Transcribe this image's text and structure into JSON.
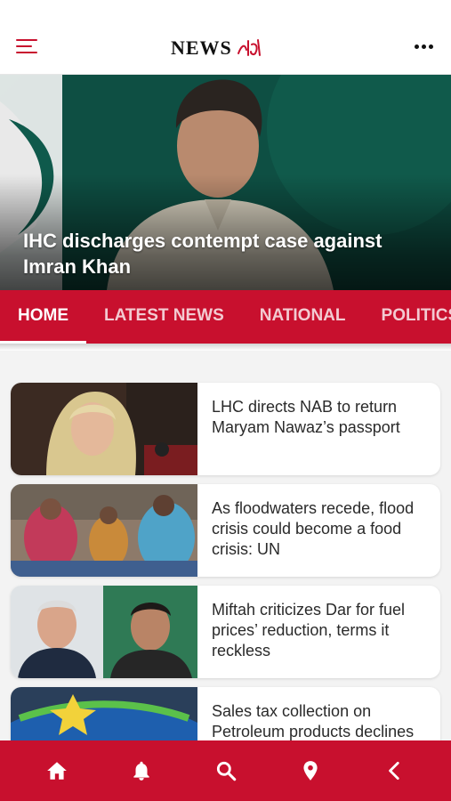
{
  "header": {
    "logo_text": "NEWS",
    "logo_urdu": "ایف ایم",
    "menu_icon": "hamburger-menu-icon",
    "more_icon": "more-dots-icon"
  },
  "hero": {
    "title": "IHC discharges contempt case against Imran Khan"
  },
  "tabs": [
    {
      "label": "HOME",
      "active": true
    },
    {
      "label": "LATEST NEWS",
      "active": false
    },
    {
      "label": "NATIONAL",
      "active": false
    },
    {
      "label": "POLITICS",
      "active": false
    }
  ],
  "articles": [
    {
      "title": "LHC directs NAB to return Maryam Nawaz’s passport"
    },
    {
      "title": "As floodwaters recede, flood crisis could become a food crisis: UN"
    },
    {
      "title": "Miftah criticizes Dar for fuel prices’ reduction, terms it reckless"
    },
    {
      "title": "Sales tax collection on Petroleum products declines"
    }
  ],
  "bottom_nav": [
    {
      "icon": "home-icon"
    },
    {
      "icon": "bell-icon"
    },
    {
      "icon": "search-icon"
    },
    {
      "icon": "location-pin-icon"
    },
    {
      "icon": "back-chevron-icon"
    }
  ],
  "colors": {
    "brand_red": "#c8102e",
    "background": "#f3f3f3",
    "text": "#2a2a2a"
  }
}
